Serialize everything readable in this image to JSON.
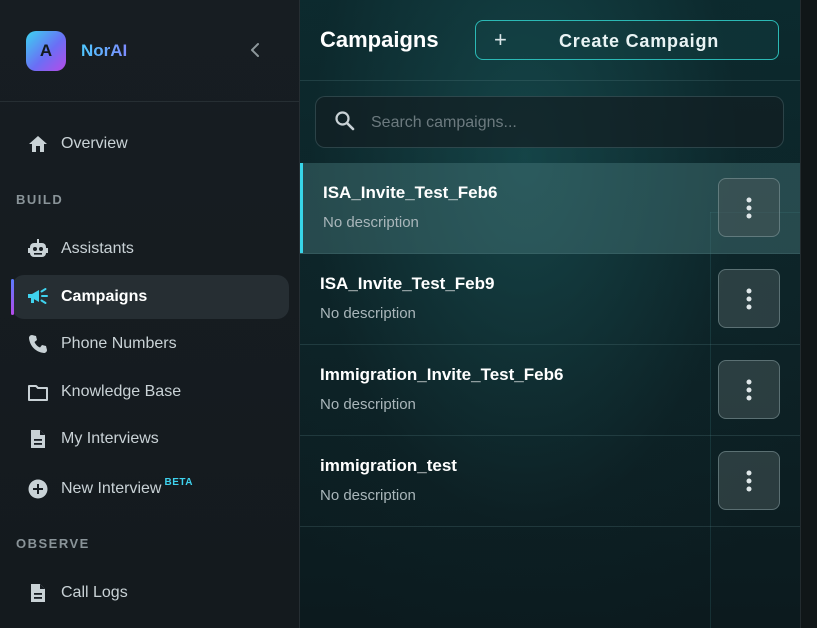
{
  "brand": {
    "logo_letter": "A",
    "name": "NorAI"
  },
  "nav": {
    "overview": "Overview",
    "sections": {
      "build": "BUILD",
      "observe": "OBSERVE"
    },
    "items": [
      {
        "label": "Assistants",
        "icon": "robot-icon"
      },
      {
        "label": "Campaigns",
        "icon": "megaphone-icon",
        "active": true
      },
      {
        "label": "Phone Numbers",
        "icon": "phone-icon"
      },
      {
        "label": "Knowledge Base",
        "icon": "folder-icon"
      },
      {
        "label": "My Interviews",
        "icon": "document-icon"
      },
      {
        "label": "New Interview",
        "icon": "plus-circle-icon",
        "badge": "BETA"
      },
      {
        "label": "Call Logs",
        "icon": "document-icon"
      }
    ]
  },
  "header": {
    "title": "Campaigns",
    "create_label": "Create Campaign"
  },
  "search": {
    "placeholder": "Search campaigns...",
    "value": ""
  },
  "campaigns": [
    {
      "name": "ISA_Invite_Test_Feb6",
      "description": "No description",
      "selected": true
    },
    {
      "name": "ISA_Invite_Test_Feb9",
      "description": "No description"
    },
    {
      "name": "Immigration_Invite_Test_Feb6",
      "description": "No description"
    },
    {
      "name": "immigration_test",
      "description": "No description"
    }
  ],
  "colors": {
    "accent": "#38d5e8",
    "active_icon": "#3fd3ef",
    "bg": "#0f1519"
  }
}
